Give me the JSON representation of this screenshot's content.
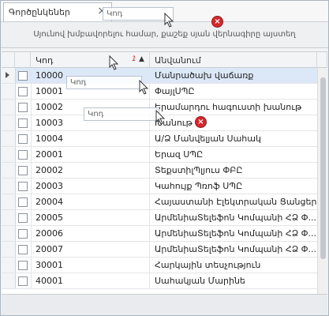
{
  "tab": {
    "label": "Գործընկեներ",
    "close_icon": "×"
  },
  "group_panel": {
    "hint": "Սյունով խմբավորելու համար, քաշեք սյան վերնագիրը այստեղ"
  },
  "columns": {
    "code": "Կոդ",
    "sort_index": "1",
    "sort_icon": "▲",
    "name": "Անվանում"
  },
  "drag": {
    "ghost_label": "Կոդ",
    "cancel_icon": "×"
  },
  "rows": [
    {
      "code": "10000",
      "name": "Մանրածախ վաճառք"
    },
    {
      "code": "10001",
      "name": "ՓայլՍՊԸ"
    },
    {
      "code": "10002",
      "name": "Երամարդու հագուստի խանութ"
    },
    {
      "code": "10003",
      "name": "Խանութ N"
    },
    {
      "code": "10004",
      "name": "Ա/Ձ Մանվելյան Սահակ"
    },
    {
      "code": "20001",
      "name": "Երազ ՍՊԸ"
    },
    {
      "code": "20002",
      "name": "ՏեքստիլՊլյուս  ՓԲԸ"
    },
    {
      "code": "20003",
      "name": "Կահույք Պռոֆ ՍՊԸ"
    },
    {
      "code": "20004",
      "name": "Հայաստանի Էլեկտրական Ցանցեր..."
    },
    {
      "code": "20005",
      "name": "ԱրմենիաՏելեֆոն Կոմպանի ՀՁ Փ..."
    },
    {
      "code": "20006",
      "name": "ԱրմենիաՏելեֆոն Կոմպանի ՀՁ Փ..."
    },
    {
      "code": "20007",
      "name": "ԱրմենիաՏելեֆոն Կոմպանի ՀՁ Փ..."
    },
    {
      "code": "30001",
      "name": "Հարկային տեսչություն"
    },
    {
      "code": "40001",
      "name": "Սահակյան Մարինե"
    }
  ]
}
